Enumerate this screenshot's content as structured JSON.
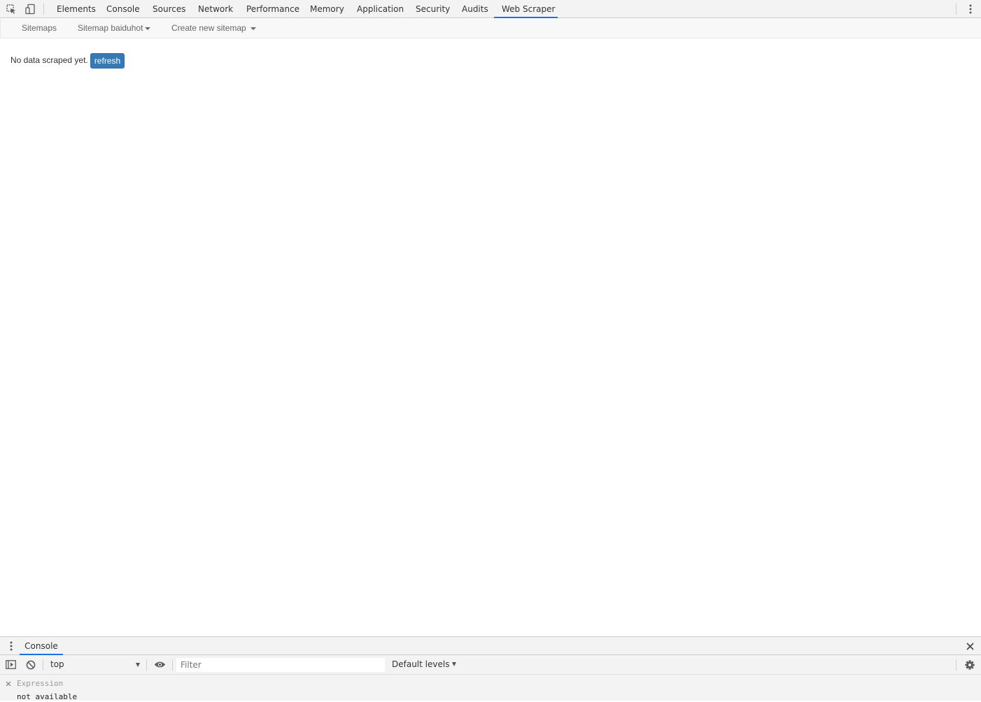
{
  "devtools": {
    "tabs": [
      {
        "label": "Elements"
      },
      {
        "label": "Console"
      },
      {
        "label": "Sources"
      },
      {
        "label": "Network"
      },
      {
        "label": "Performance"
      },
      {
        "label": "Memory"
      },
      {
        "label": "Application"
      },
      {
        "label": "Security"
      },
      {
        "label": "Audits"
      },
      {
        "label": "Web Scraper",
        "active": true
      }
    ],
    "icons": {
      "inspect": "element-picker-icon",
      "device": "device-toggle-icon",
      "more": "more-vertical-icon"
    },
    "accent_color": "#1a73e8"
  },
  "scraper": {
    "nav": {
      "sitemaps": "Sitemaps",
      "sitemap_menu": "Sitemap baiduhot",
      "create_menu": "Create new sitemap"
    },
    "message": "No data scraped yet.",
    "refresh_label": "refresh",
    "button_color": "#337ab7"
  },
  "drawer": {
    "tab_label": "Console",
    "context": "top",
    "filter_placeholder": "Filter",
    "levels": "Default levels",
    "watch": {
      "expression_placeholder": "Expression",
      "value": "not available"
    }
  }
}
